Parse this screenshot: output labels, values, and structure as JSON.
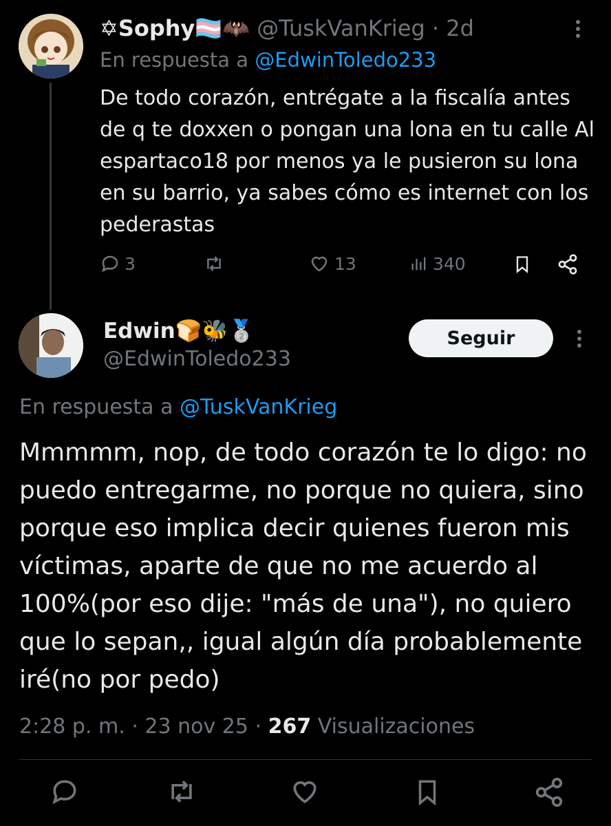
{
  "tweet1": {
    "display_name": "✡Sophy",
    "name_emojis": "🏳️‍⚧️🦇",
    "handle": "@TuskVanKrieg",
    "separator": "·",
    "time": "2d",
    "reply_prefix": "En respuesta a",
    "reply_to": "@EdwinToledo233",
    "text": "De todo corazón, entrégate a la fiscalía antes de q te doxxen o pongan una lona en tu calle Al espartaco18 por menos ya le pusieron su lona en su barrio, ya sabes cómo es internet con los pederastas",
    "stats": {
      "replies": "3",
      "retweets": "",
      "likes": "13",
      "views": "340"
    },
    "icons": [
      "more-icon",
      "reply-icon",
      "retweet-icon",
      "like-icon",
      "views-icon",
      "bookmark-icon",
      "share-icon"
    ]
  },
  "tweet2": {
    "display_name": "Edwin",
    "name_emojis": "🍞🐝🥈",
    "handle": "@EdwinToledo233",
    "follow_label": "Seguir",
    "reply_prefix": "En respuesta a",
    "reply_to": "@TuskVanKrieg",
    "text": "Mmmmm, nop, de todo corazón te lo digo: no puedo entregarme, no porque no quiera, sino porque eso implica decir quienes fueron mis víctimas, aparte de que no me acuerdo al 100%(por eso dije: \"más de una\"), no quiero que lo sepan,, igual algún día probablemente iré(no por pedo)",
    "time": "2:28 p. m.",
    "date": "23 nov 25",
    "separator": "·",
    "views_count": "267",
    "views_label": "Visualizaciones"
  },
  "colors": {
    "background": "#000000",
    "text": "#e7e9ea",
    "muted": "#71767b",
    "link": "#1d9bf0",
    "follow_button_bg": "#eff3f4"
  }
}
